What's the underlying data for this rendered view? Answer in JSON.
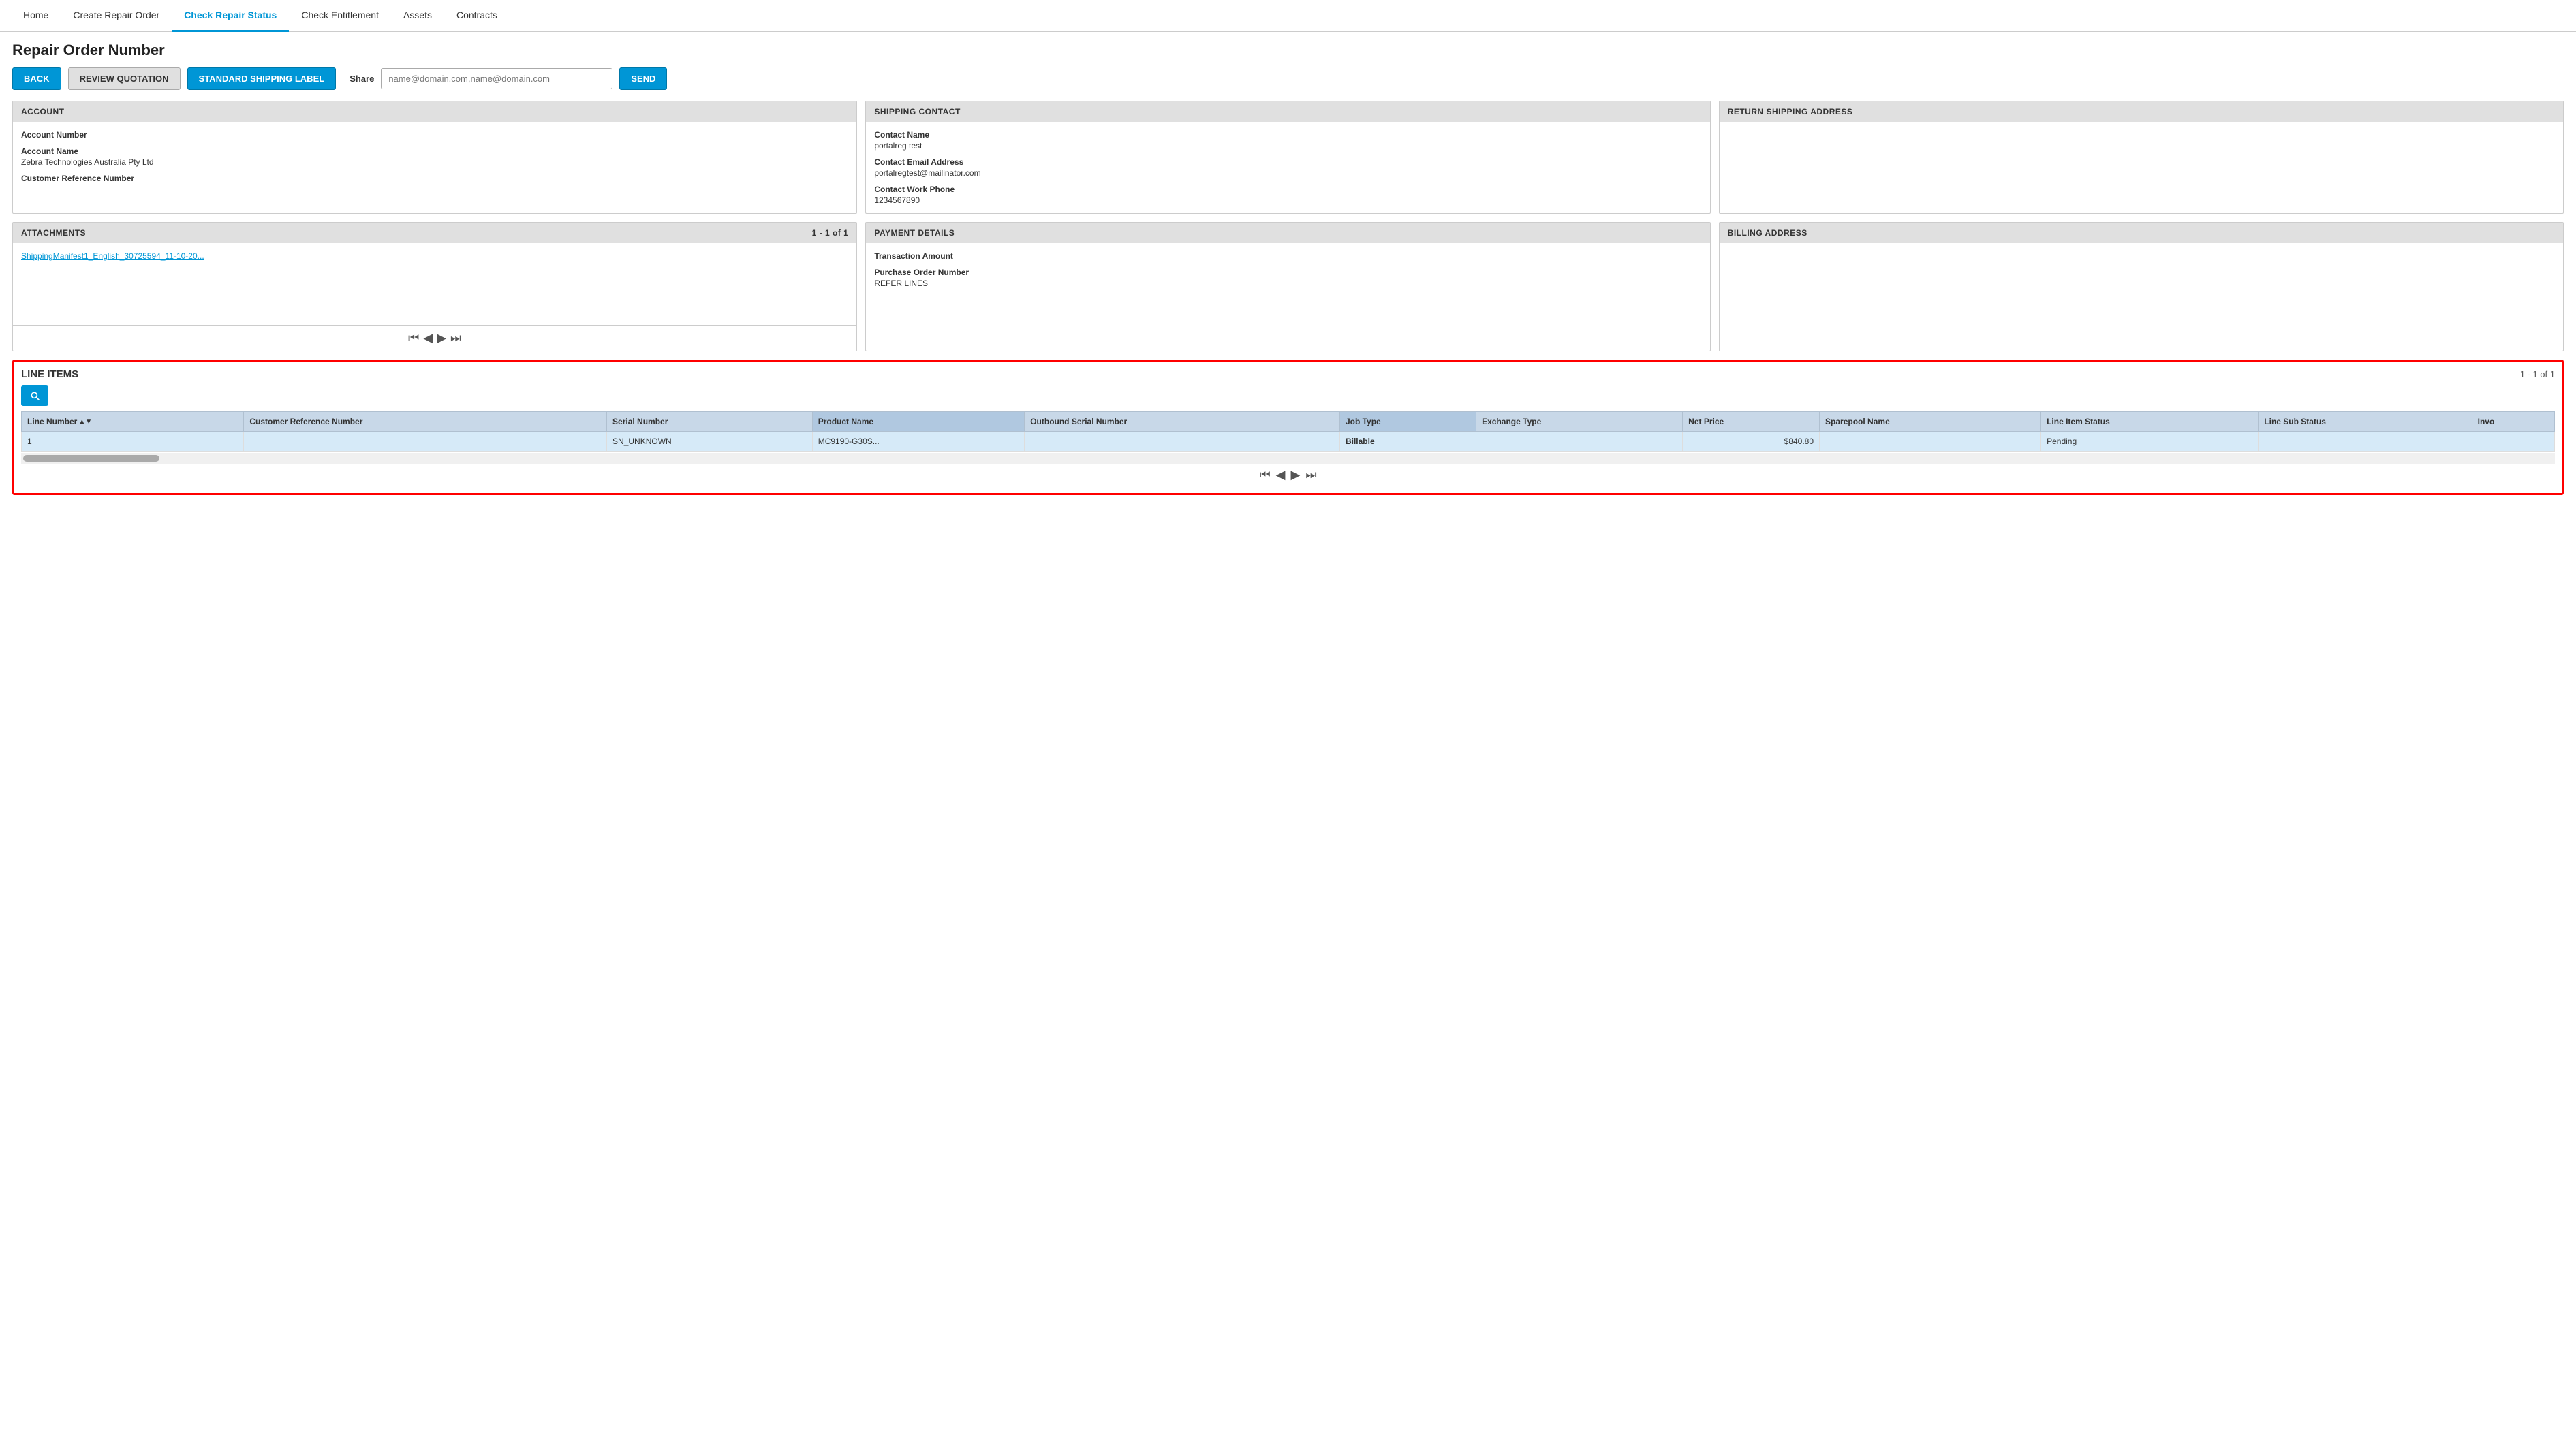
{
  "nav": {
    "items": [
      {
        "id": "home",
        "label": "Home",
        "active": false
      },
      {
        "id": "create-repair-order",
        "label": "Create Repair Order",
        "active": false
      },
      {
        "id": "check-repair-status",
        "label": "Check Repair Status",
        "active": true
      },
      {
        "id": "check-entitlement",
        "label": "Check Entitlement",
        "active": false
      },
      {
        "id": "assets",
        "label": "Assets",
        "active": false
      },
      {
        "id": "contracts",
        "label": "Contracts",
        "active": false
      }
    ]
  },
  "page": {
    "title": "Repair Order Number",
    "toolbar": {
      "back_label": "BACK",
      "review_label": "REVIEW QUOTATION",
      "shipping_label": "STANDARD SHIPPING LABEL",
      "share_label": "Share",
      "share_placeholder": "name@domain.com,name@domain.com",
      "send_label": "SEND"
    }
  },
  "account_panel": {
    "header": "ACCOUNT",
    "fields": [
      {
        "label": "Account Number",
        "value": ""
      },
      {
        "label": "Account Name",
        "value": "Zebra Technologies Australia Pty Ltd"
      },
      {
        "label": "Customer Reference Number",
        "value": ""
      }
    ]
  },
  "shipping_contact_panel": {
    "header": "SHIPPING CONTACT",
    "fields": [
      {
        "label": "Contact Name",
        "value": "portalreg test"
      },
      {
        "label": "Contact Email Address",
        "value": "portalregtest@mailinator.com"
      },
      {
        "label": "Contact Work Phone",
        "value": "1234567890"
      }
    ]
  },
  "return_shipping_panel": {
    "header": "RETURN SHIPPING ADDRESS",
    "fields": []
  },
  "attachments_panel": {
    "header": "ATTACHMENTS",
    "count": "1 - 1 of 1",
    "link": "ShippingManifest1_English_30725594_11-10-20..."
  },
  "payment_panel": {
    "header": "PAYMENT DETAILS",
    "fields": [
      {
        "label": "Transaction Amount",
        "value": ""
      },
      {
        "label": "Purchase Order Number",
        "value": "REFER LINES"
      }
    ]
  },
  "billing_panel": {
    "header": "BILLING ADDRESS",
    "fields": []
  },
  "line_items": {
    "title": "LINE ITEMS",
    "count": "1 - 1 of 1",
    "columns": [
      {
        "id": "line-number",
        "label": "Line Number",
        "sortable": true
      },
      {
        "id": "customer-ref",
        "label": "Customer Reference Number",
        "sortable": false
      },
      {
        "id": "serial-number",
        "label": "Serial Number",
        "sortable": false
      },
      {
        "id": "product-name",
        "label": "Product Name",
        "sortable": false
      },
      {
        "id": "outbound-serial",
        "label": "Outbound Serial Number",
        "sortable": false
      },
      {
        "id": "job-type",
        "label": "Job Type",
        "sortable": false
      },
      {
        "id": "exchange-type",
        "label": "Exchange Type",
        "sortable": false
      },
      {
        "id": "net-price",
        "label": "Net Price",
        "sortable": false
      },
      {
        "id": "sparepool-name",
        "label": "Sparepool Name",
        "sortable": false
      },
      {
        "id": "line-item-status",
        "label": "Line Item Status",
        "sortable": false
      },
      {
        "id": "line-sub-status",
        "label": "Line Sub Status",
        "sortable": false
      },
      {
        "id": "invoice",
        "label": "Invo",
        "sortable": false
      }
    ],
    "rows": [
      {
        "line_number": "1",
        "customer_ref": "",
        "serial_number": "SN_UNKNOWN",
        "product_name": "MC9190-G30S...",
        "outbound_serial": "",
        "job_type": "Billable",
        "exchange_type": "",
        "net_price": "$840.80",
        "sparepool_name": "",
        "line_item_status": "Pending",
        "line_sub_status": "",
        "invoice": ""
      }
    ]
  },
  "pagination": {
    "first": "⏮",
    "prev": "◀",
    "next": "▶",
    "last": "⏭"
  }
}
